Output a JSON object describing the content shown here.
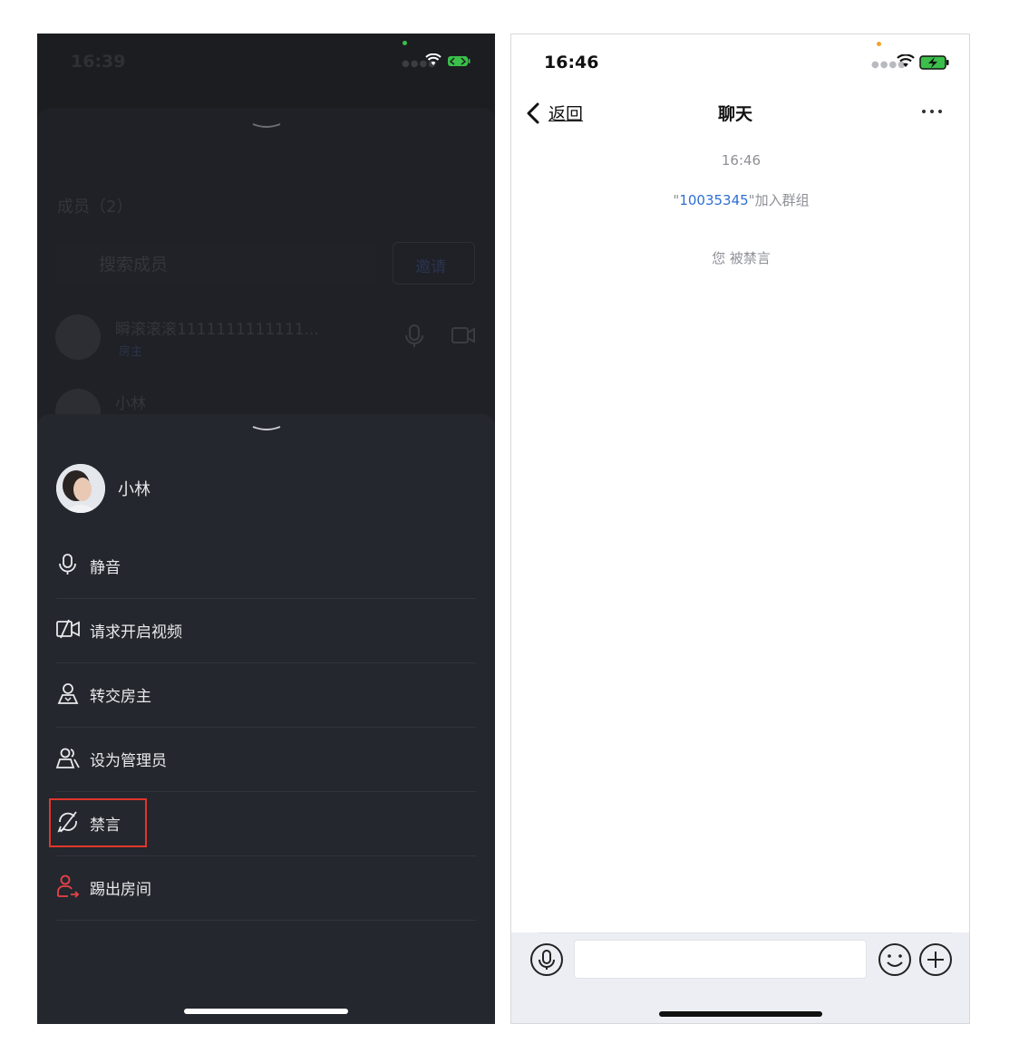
{
  "left_phone": {
    "status_time": "16:39",
    "background": {
      "members_title": "成员（2）",
      "search_placeholder": "搜索成员",
      "invite_label": "邀请",
      "members": [
        {
          "name": "瞬滚滚滚1111111111111...",
          "role": "房主"
        },
        {
          "name": "小林"
        }
      ]
    },
    "sheet": {
      "user_name": "小林",
      "items": [
        {
          "label": "静音",
          "icon": "microphone-icon"
        },
        {
          "label": "请求开启视频",
          "icon": "camera-off-icon"
        },
        {
          "label": "转交房主",
          "icon": "user-icon"
        },
        {
          "label": "设为管理员",
          "icon": "users-icon"
        },
        {
          "label": "禁言",
          "icon": "mute-chat-icon"
        },
        {
          "label": "踢出房间",
          "icon": "user-remove-icon"
        }
      ],
      "highlight_color": "#e0362b",
      "danger_icon_color": "#e8424a"
    }
  },
  "right_phone": {
    "status_time": "16:46",
    "back_label": "返回",
    "nav_title": "聊天",
    "messages": {
      "time": "16:46",
      "join_prefix": "\"",
      "join_uid": "10035345",
      "join_suffix": "\"加入群组",
      "muted": "您 被禁言"
    },
    "uid_color": "#2f6fd4"
  }
}
